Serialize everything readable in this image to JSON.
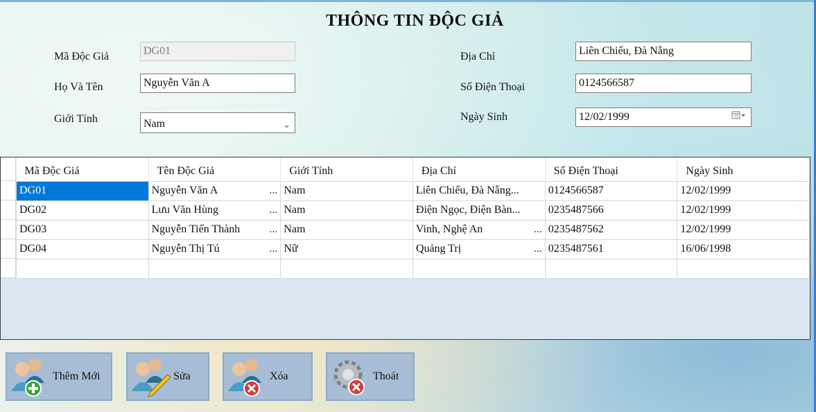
{
  "title": "THÔNG TIN ĐỘC GIẢ",
  "form": {
    "ma_label": "Mã Độc Giả",
    "ma_value": "DG01",
    "ten_label": "Họ Và Tên",
    "ten_value": "Nguyễn Văn A",
    "gioitinh_label": "Giới Tính",
    "gioitinh_value": "Nam",
    "diachi_label": "Địa Chỉ",
    "diachi_value": "Liên Chiểu, Đà Nẵng",
    "sdt_label": "Số Điện Thoại",
    "sdt_value": "0124566587",
    "ngaysinh_label": "Ngày Sinh",
    "ngaysinh_value": "12/02/1999"
  },
  "grid": {
    "headers": [
      "Mã Độc Giả",
      "Tên Độc Giả",
      "Giới Tính",
      "Địa Chỉ",
      "Số Điện Thoại",
      "Ngày Sinh"
    ],
    "rows": [
      [
        "DG01",
        "Nguyễn Văn A",
        "Nam",
        "Liên Chiểu, Đà Nẵng...",
        "0124566587",
        "12/02/1999"
      ],
      [
        "DG02",
        "Lưu Văn Hùng",
        "Nam",
        "Điện Ngọc, Điện Bàn...",
        "0235487566",
        "12/02/1999"
      ],
      [
        "DG03",
        "Nguyễn Tiến Thành",
        "Nam",
        "Vinh, Nghệ An",
        "0235487562",
        "12/02/1999"
      ],
      [
        "DG04",
        "Nguyễn Thị Tú",
        "Nữ",
        "Quảng Trị",
        "0235487561",
        "16/06/1998"
      ]
    ],
    "ellipsis": "..."
  },
  "buttons": {
    "them": "Thêm Mới",
    "sua": "Sửa",
    "xoa": "Xóa",
    "thoat": "Thoát"
  },
  "icons": {
    "dropdown": "chevron-down-icon",
    "calendar": "calendar-icon"
  }
}
